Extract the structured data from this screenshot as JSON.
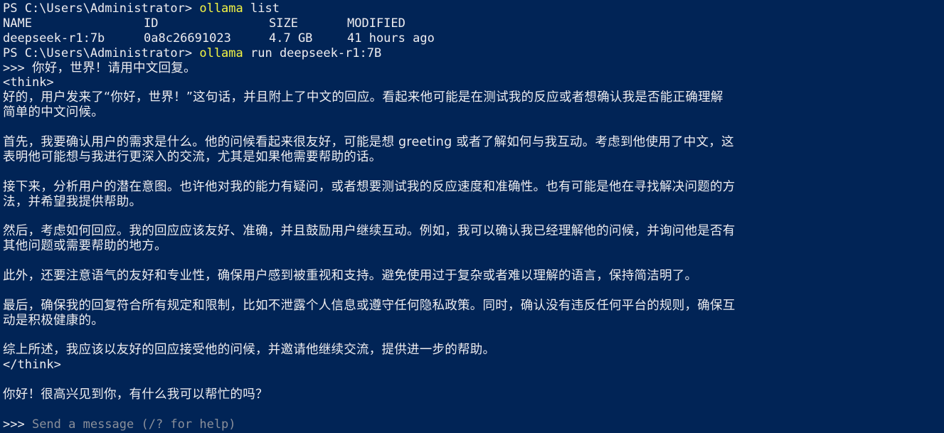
{
  "prompt": "PS C:\\Users\\Administrator> ",
  "command1": {
    "program": "ollama",
    "args": " list"
  },
  "list_table": {
    "headers": [
      "NAME",
      "ID",
      "SIZE",
      "MODIFIED"
    ],
    "rows": [
      [
        "deepseek-r1:7b",
        "0a8c26691023",
        "4.7 GB",
        "41 hours ago"
      ]
    ]
  },
  "command2": {
    "program": "ollama",
    "args": " run deepseek-r1:7B"
  },
  "chat": {
    "user_prompt_marker": ">>> ",
    "user_message": "你好，世界！请用中文回复。",
    "think_open": "<think>",
    "think_lines": [
      "好的，用户发来了“你好，世界！”这句话，并且附上了中文的回应。看起来他可能是在测试我的反应或者想确认我是否能正确理解",
      "简单的中文问候。",
      "",
      "首先，我要确认用户的需求是什么。他的问候看起来很友好，可能是想 greeting 或者了解如何与我互动。考虑到他使用了中文，这",
      "表明他可能想与我进行更深入的交流，尤其是如果他需要帮助的话。",
      "",
      "接下来，分析用户的潜在意图。也许他对我的能力有疑问，或者想要测试我的反应速度和准确性。也有可能是他在寻找解决问题的方",
      "法，并希望我提供帮助。",
      "",
      "然后，考虑如何回应。我的回应应该友好、准确，并且鼓励用户继续互动。例如，我可以确认我已经理解他的问候，并询问他是否有",
      "其他问题或需要帮助的地方。",
      "",
      "此外，还要注意语气的友好和专业性，确保用户感到被重视和支持。避免使用过于复杂或者难以理解的语言，保持简洁明了。",
      "",
      "最后，确保我的回复符合所有规定和限制，比如不泄露个人信息或遵守任何隐私政策。同时，确认没有违反任何平台的规则，确保互",
      "动是积极健康的。",
      "",
      "综上所述，我应该以友好的回应接受他的问候，并邀请他继续交流，提供进一步的帮助。"
    ],
    "think_close": "</think>",
    "assistant_reply": "你好！很高兴见到你，有什么我可以帮忙的吗？",
    "input_marker": ">>> ",
    "input_placeholder": "Send a message (/? for help)"
  },
  "colors": {
    "background": "#012456",
    "foreground": "#eeedf0",
    "command": "#f5f543",
    "placeholder": "#8a8f9a"
  }
}
